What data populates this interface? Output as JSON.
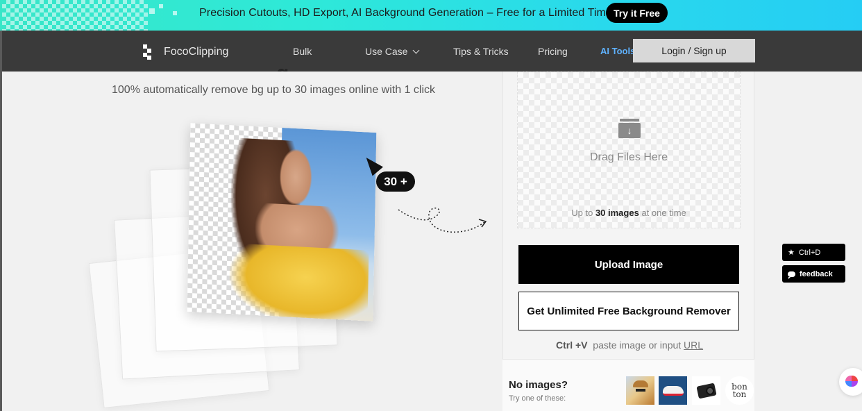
{
  "promo": {
    "text": "Precision Cutouts, HD Export, AI Background Generation – Free for a Limited Time",
    "button": "Try it Free"
  },
  "nav": {
    "logo": "FocoClipping",
    "items": [
      "Bulk",
      "Use Case",
      "Tips & Tricks",
      "Pricing"
    ],
    "ai_tools": "AI Tools",
    "login": "Login / Sign up"
  },
  "hero": {
    "title_fragment": "g",
    "subtitle": "100% automatically remove bg up to 30 images online with 1 click",
    "badge": "30 +"
  },
  "uploader": {
    "drop_title": "Drag Files Here",
    "limit_prefix": "Up to",
    "limit_count": "30 images",
    "limit_suffix": "at one time",
    "upload_button": "Upload Image",
    "unlimited_button": "Get Unlimited Free Background Remover",
    "paste_shortcut": "Ctrl +V",
    "paste_text": "paste image or input",
    "paste_link": "URL"
  },
  "samples": {
    "title": "No images?",
    "subtitle": "Try one of these:",
    "brand_thumb": "bon ton"
  },
  "floating": {
    "shortcut": "Ctrl+D",
    "feedback": "feedback"
  }
}
